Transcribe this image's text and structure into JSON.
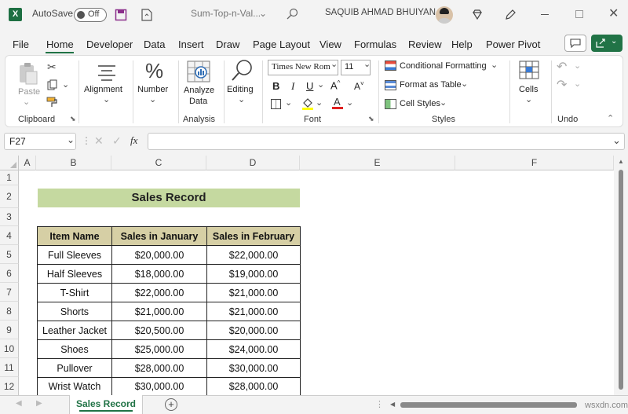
{
  "titlebar": {
    "autosave_label": "AutoSave",
    "toggle_state": "Off",
    "filename": "Sum-Top-n-Val...",
    "user_name": "SAQUIB AHMAD BHUIYAN"
  },
  "tabs": [
    "File",
    "Home",
    "Developer",
    "Data",
    "Insert",
    "Draw",
    "Page Layout",
    "View",
    "Formulas",
    "Review",
    "Help",
    "Power Pivot"
  ],
  "active_tab": "Home",
  "ribbon": {
    "paste": "Paste",
    "clipboard": "Clipboard",
    "alignment": "Alignment",
    "number": "Number",
    "analyze_data_line1": "Analyze",
    "analyze_data_line2": "Data",
    "analysis": "Analysis",
    "editing": "Editing",
    "font_name": "Times New Rom",
    "font_size": "11",
    "font_group": "Font",
    "conditional_formatting": "Conditional Formatting",
    "format_as_table": "Format as Table",
    "cell_styles": "Cell Styles",
    "styles": "Styles",
    "cells": "Cells",
    "undo": "Undo"
  },
  "formula_bar": {
    "name_box": "F27",
    "fx": "fx",
    "content": ""
  },
  "columns": [
    "A",
    "B",
    "C",
    "D",
    "E",
    "F"
  ],
  "rows": [
    "1",
    "2",
    "3",
    "4",
    "5",
    "6",
    "7",
    "8",
    "9",
    "10",
    "11",
    "12"
  ],
  "sheet": {
    "title": "Sales Record",
    "headers": [
      "Item Name",
      "Sales in January",
      "Sales in February"
    ],
    "data": [
      [
        "Full Sleeves",
        "$20,000.00",
        "$22,000.00"
      ],
      [
        "Half Sleeves",
        "$18,000.00",
        "$19,000.00"
      ],
      [
        "T-Shirt",
        "$22,000.00",
        "$21,000.00"
      ],
      [
        "Shorts",
        "$21,000.00",
        "$21,000.00"
      ],
      [
        "Leather Jacket",
        "$20,500.00",
        "$20,000.00"
      ],
      [
        "Shoes",
        "$25,000.00",
        "$24,000.00"
      ],
      [
        "Pullover",
        "$28,000.00",
        "$30,000.00"
      ],
      [
        "Wrist Watch",
        "$30,000.00",
        "$28,000.00"
      ]
    ]
  },
  "sheet_tab": "Sales Record",
  "watermark": "wsxdn.com",
  "colors": {
    "accent": "#217346",
    "title_fill": "#c5d9a0",
    "header_fill": "#d6cfa5"
  }
}
